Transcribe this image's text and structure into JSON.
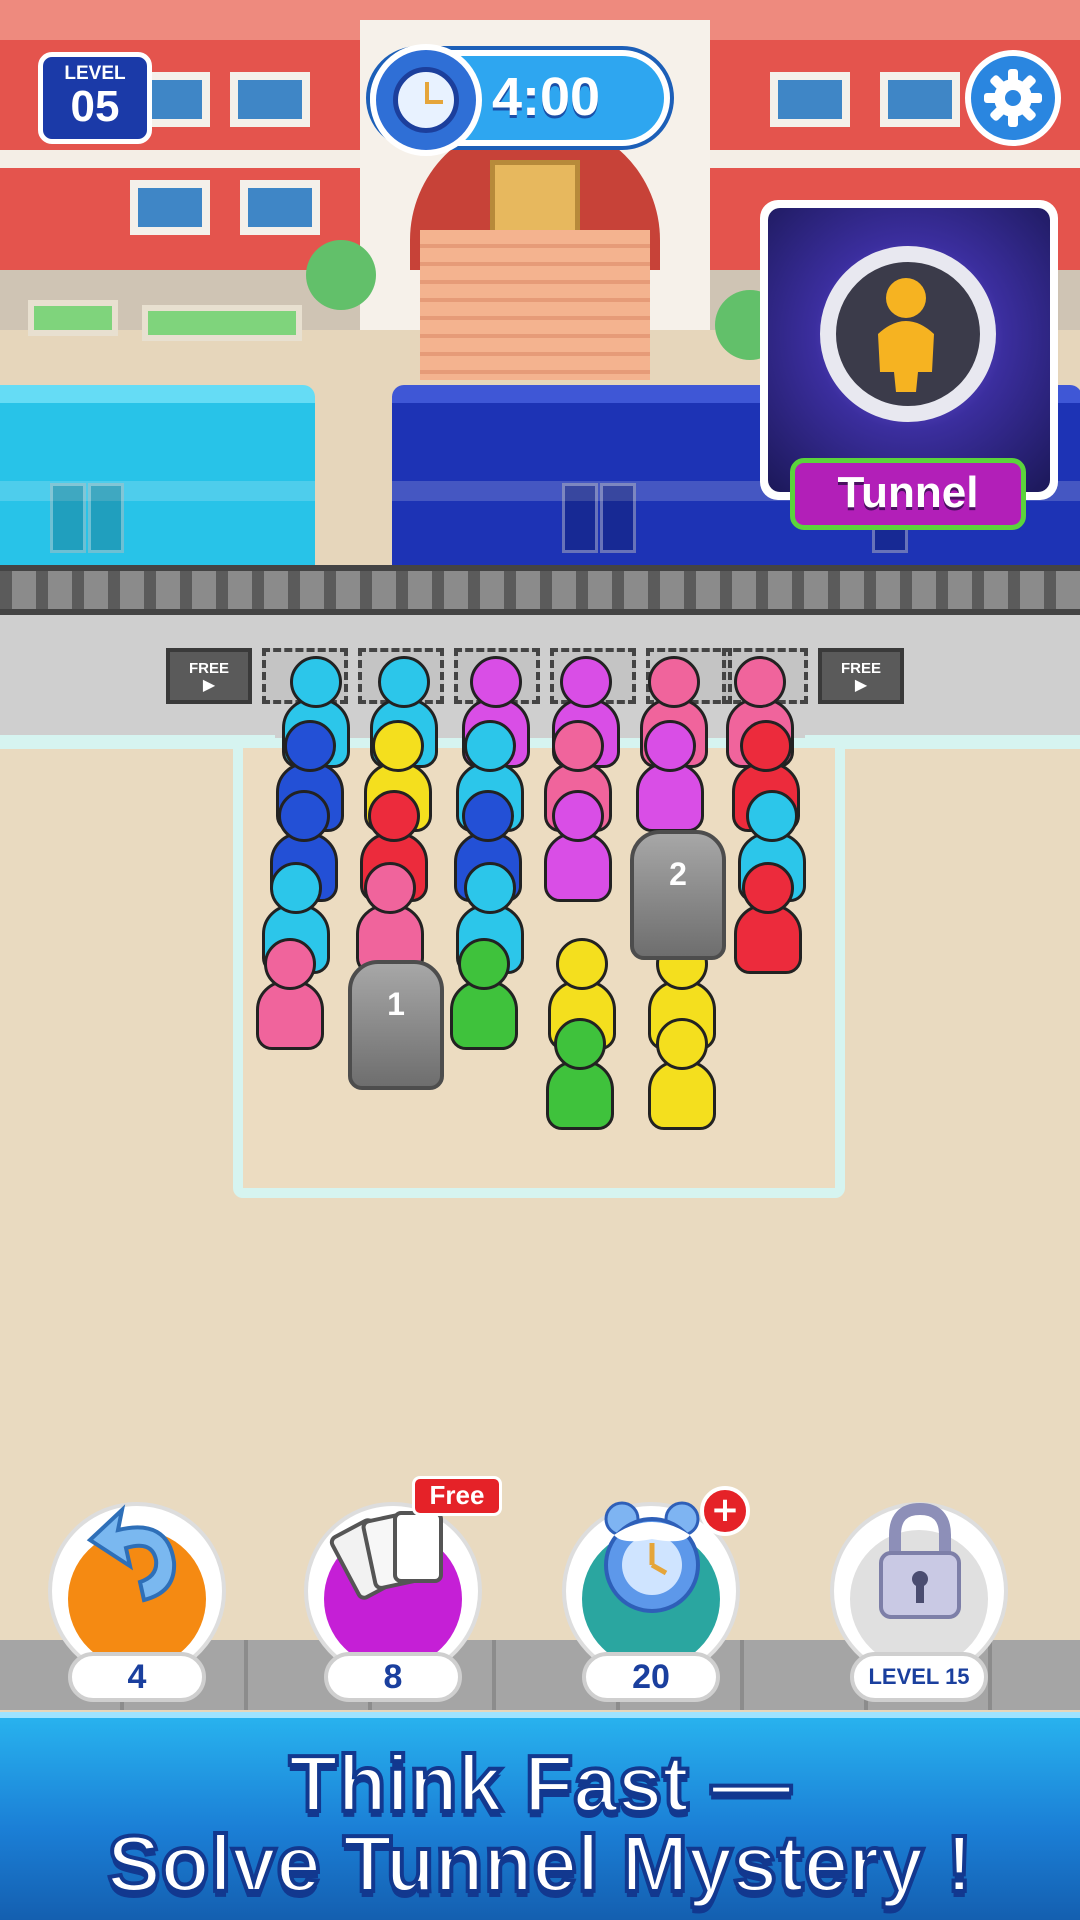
{
  "hud": {
    "level_label": "LEVEL",
    "level_number": "05",
    "timer": "4:00",
    "settings_icon": "gear-icon"
  },
  "unlock_card": {
    "label": "Tunnel",
    "icon": "person-in-tunnel-icon"
  },
  "platform": {
    "slots": [
      {
        "label": "FREE",
        "icon": "video-icon",
        "type": "free"
      },
      {
        "label": "",
        "type": "empty"
      },
      {
        "label": "",
        "type": "empty"
      },
      {
        "label": "",
        "type": "empty"
      },
      {
        "label": "",
        "type": "empty"
      },
      {
        "label": "",
        "type": "empty"
      },
      {
        "label": "",
        "type": "empty"
      },
      {
        "label": "FREE",
        "icon": "video-icon",
        "type": "free"
      }
    ]
  },
  "board": {
    "tunnels": [
      {
        "number": "1"
      },
      {
        "number": "2"
      }
    ],
    "colors": {
      "cyan": "#2cc6ea",
      "magenta": "#d94ee6",
      "pink": "#f0649c",
      "blue": "#2350d6",
      "yellow": "#f4df1e",
      "red": "#ec2b3c",
      "green": "#3fc23c"
    }
  },
  "boosters": [
    {
      "name": "undo",
      "count": "4",
      "icon": "undo-arrow-icon",
      "color": "#f58a12"
    },
    {
      "name": "shuffle",
      "count": "8",
      "icon": "cards-icon",
      "color": "#c51fd6",
      "tag": "Free"
    },
    {
      "name": "freeze",
      "count": "20",
      "icon": "frozen-clock-icon",
      "color": "#2aa6a0",
      "tag": "+"
    },
    {
      "name": "locked",
      "count": "LEVEL 15",
      "icon": "padlock-icon",
      "color": "#e0e0e0"
    }
  ],
  "banner": {
    "line1": "Think Fast —",
    "line2": "Solve Tunnel Mystery !"
  }
}
